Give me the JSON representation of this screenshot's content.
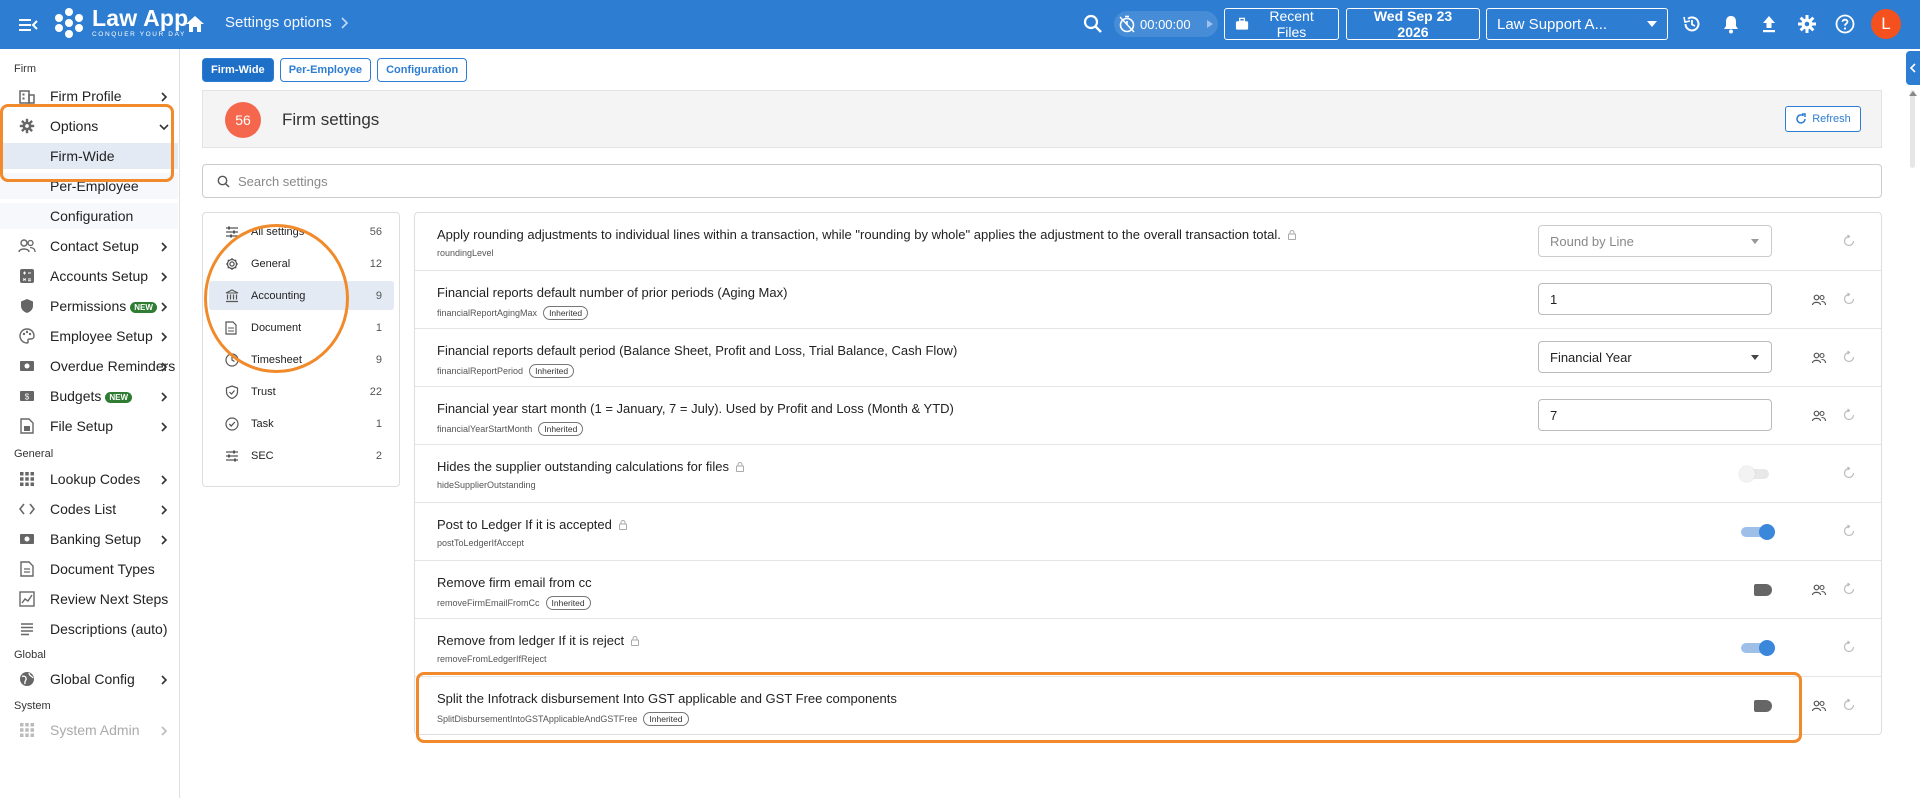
{
  "topbar": {
    "app_title": "Law App",
    "app_tagline": "CONQUER YOUR DAY",
    "breadcrumb": "Settings options",
    "timer": "00:00:00",
    "recent_files": "Recent Files",
    "date": "Wed Sep 23 2026",
    "workspace": "Law Support A...",
    "avatar_initial": "L"
  },
  "sidebar": {
    "sections": {
      "firm": "Firm",
      "general": "General",
      "global": "Global",
      "system": "System"
    },
    "items": {
      "firm_profile": "Firm Profile",
      "options": "Options",
      "firm_wide": "Firm-Wide",
      "per_employee": "Per-Employee",
      "configuration": "Configuration",
      "contact_setup": "Contact Setup",
      "accounts_setup": "Accounts Setup",
      "permissions": "Permissions",
      "employee_setup": "Employee Setup",
      "overdue_reminders": "Overdue Reminders",
      "budgets": "Budgets",
      "file_setup": "File Setup",
      "lookup_codes": "Lookup Codes",
      "codes_list": "Codes List",
      "banking_setup": "Banking Setup",
      "document_types": "Document Types",
      "review_next_steps": "Review Next Steps",
      "descriptions_auto": "Descriptions (auto)",
      "global_config": "Global Config",
      "system_admin": "System Admin"
    },
    "new_badge": "NEW"
  },
  "tabs": [
    "Firm-Wide",
    "Per-Employee",
    "Configuration"
  ],
  "header": {
    "count": "56",
    "title": "Firm settings",
    "refresh": "Refresh"
  },
  "search": {
    "placeholder": "Search settings"
  },
  "categories": [
    {
      "label": "All settings",
      "count": "56"
    },
    {
      "label": "General",
      "count": "12"
    },
    {
      "label": "Accounting",
      "count": "9"
    },
    {
      "label": "Document",
      "count": "1"
    },
    {
      "label": "Timesheet",
      "count": "9"
    },
    {
      "label": "Trust",
      "count": "22"
    },
    {
      "label": "Task",
      "count": "1"
    },
    {
      "label": "SEC",
      "count": "2"
    }
  ],
  "inherited_label": "Inherited",
  "settings": [
    {
      "title": "Apply rounding adjustments to individual lines within a transaction, while \"rounding by whole\" applies the adjustment to the overall transaction total.",
      "key": "roundingLevel",
      "value": "Round by Line"
    },
    {
      "title": "Financial reports default number of prior periods (Aging Max)",
      "key": "financialReportAgingMax",
      "value": "1"
    },
    {
      "title": "Financial reports default period (Balance Sheet, Profit and Loss, Trial Balance, Cash Flow)",
      "key": "financialReportPeriod",
      "value": "Financial Year"
    },
    {
      "title": "Financial year start month (1 = January, 7 = July). Used by Profit and Loss (Month & YTD)",
      "key": "financialYearStartMonth",
      "value": "7"
    },
    {
      "title": "Hides the supplier outstanding calculations for files",
      "key": "hideSupplierOutstanding",
      "enabled": false
    },
    {
      "title": "Post to Ledger If it is accepted",
      "key": "postToLedgerIfAccept",
      "enabled": true
    },
    {
      "title": "Remove firm email from cc",
      "key": "removeFirmEmailFromCc",
      "enabled": false
    },
    {
      "title": "Remove from ledger If it is reject",
      "key": "removeFromLedgerIfReject",
      "enabled": true
    },
    {
      "title": "Split the Infotrack disbursement Into GST applicable and GST Free components",
      "key": "SplitDisbursementIntoGSTApplicableAndGSTFree",
      "enabled": false
    }
  ],
  "colors": {
    "topbar": "#2d7dd2",
    "annotation": "#f08a2a",
    "count_circle": "#f5674d"
  }
}
